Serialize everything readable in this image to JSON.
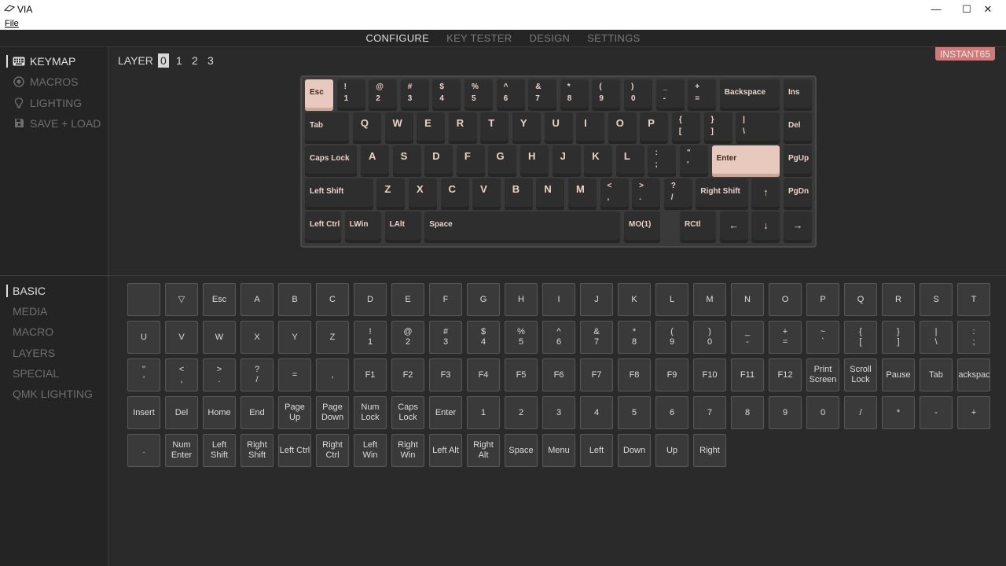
{
  "window": {
    "title": "VIA",
    "minimize": "—",
    "maximize": "☐",
    "close": "✕"
  },
  "menu": {
    "file": "File"
  },
  "nav": {
    "tabs": [
      "CONFIGURE",
      "KEY TESTER",
      "DESIGN",
      "SETTINGS"
    ],
    "active": "CONFIGURE"
  },
  "sidebar": {
    "items": [
      {
        "label": "KEYMAP",
        "icon": "keyboard-icon",
        "active": true
      },
      {
        "label": "MACROS",
        "icon": "macro-circle-icon",
        "active": false
      },
      {
        "label": "LIGHTING",
        "icon": "lightbulb-icon",
        "active": false
      },
      {
        "label": "SAVE + LOAD",
        "icon": "floppy-disk-icon",
        "active": false
      }
    ]
  },
  "layer": {
    "label": "LAYER",
    "options": [
      "0",
      "1",
      "2",
      "3"
    ],
    "active": "0"
  },
  "device": {
    "name": "INSTANT65"
  },
  "colors": {
    "accent_key": "#e8c9bd",
    "badge": "#cc7a7a",
    "key_legend": "#ecd2c7",
    "background": "#2a2a2a"
  },
  "keyboard": {
    "rows": [
      [
        {
          "t": "Esc",
          "accent": true
        },
        {
          "top": "!",
          "bot": "1"
        },
        {
          "top": "@",
          "bot": "2"
        },
        {
          "top": "#",
          "bot": "3"
        },
        {
          "top": "$",
          "bot": "4"
        },
        {
          "top": "%",
          "bot": "5"
        },
        {
          "top": "^",
          "bot": "6"
        },
        {
          "top": "&",
          "bot": "7"
        },
        {
          "top": "*",
          "bot": "8"
        },
        {
          "top": "(",
          "bot": "9"
        },
        {
          "top": ")",
          "bot": "0"
        },
        {
          "top": "_",
          "bot": "-"
        },
        {
          "top": "+",
          "bot": "="
        },
        {
          "t": "Backspace"
        },
        {
          "t": "Ins"
        }
      ],
      [
        {
          "t": "Tab"
        },
        {
          "big": "Q"
        },
        {
          "big": "W"
        },
        {
          "big": "E"
        },
        {
          "big": "R"
        },
        {
          "big": "T"
        },
        {
          "big": "Y"
        },
        {
          "big": "U"
        },
        {
          "big": "I"
        },
        {
          "big": "O"
        },
        {
          "big": "P"
        },
        {
          "top": "{",
          "bot": "["
        },
        {
          "top": "}",
          "bot": "]"
        },
        {
          "top": "|",
          "bot": "\\"
        },
        {
          "t": "Del"
        }
      ],
      [
        {
          "t": "Caps Lock"
        },
        {
          "big": "A"
        },
        {
          "big": "S"
        },
        {
          "big": "D"
        },
        {
          "big": "F"
        },
        {
          "big": "G"
        },
        {
          "big": "H"
        },
        {
          "big": "J"
        },
        {
          "big": "K"
        },
        {
          "big": "L"
        },
        {
          "top": ":",
          "bot": ";"
        },
        {
          "top": "\"",
          "bot": "'"
        },
        {
          "t": "Enter",
          "accent": true
        },
        {
          "t": "PgUp"
        }
      ],
      [
        {
          "t": "Left Shift"
        },
        {
          "big": "Z"
        },
        {
          "big": "X"
        },
        {
          "big": "C"
        },
        {
          "big": "V"
        },
        {
          "big": "B"
        },
        {
          "big": "N"
        },
        {
          "big": "M"
        },
        {
          "top": "<",
          "bot": ","
        },
        {
          "top": ">",
          "bot": "."
        },
        {
          "top": "?",
          "bot": "/"
        },
        {
          "t": "Right Shift"
        },
        {
          "arrow": "↑"
        },
        {
          "t": "PgDn"
        }
      ],
      [
        {
          "t": "Left Ctrl"
        },
        {
          "t": "LWin"
        },
        {
          "t": "LAlt"
        },
        {
          "t": "Space"
        },
        {
          "t": "MO(1)"
        },
        {
          "t": "RCtl"
        },
        {
          "arrow": "←"
        },
        {
          "arrow": "↓"
        },
        {
          "arrow": "→"
        }
      ]
    ]
  },
  "categories": [
    {
      "label": "BASIC",
      "active": true
    },
    {
      "label": "MEDIA",
      "active": false
    },
    {
      "label": "MACRO",
      "active": false
    },
    {
      "label": "LAYERS",
      "active": false
    },
    {
      "label": "SPECIAL",
      "active": false
    },
    {
      "label": "QMK LIGHTING",
      "active": false
    }
  ],
  "palette": [
    [
      "",
      "▽",
      "Esc",
      "A",
      "B",
      "C",
      "D",
      "E",
      "F",
      "G",
      "H",
      "I",
      "J",
      "K",
      "L",
      "M",
      "N",
      "O",
      "P",
      "Q",
      "R",
      "S",
      "T"
    ],
    [
      "U",
      "V",
      "W",
      "X",
      "Y",
      "Z",
      "!\n1",
      "@\n2",
      "#\n3",
      "$\n4",
      "%\n5",
      "^\n6",
      "&\n7",
      "*\n8",
      "(\n9",
      ")\n0",
      "_\n-",
      "+\n=",
      "~\n`",
      "{\n[",
      "}\n]",
      "|\n\\",
      ":\n;"
    ],
    [
      "\"\n'",
      "<\n,",
      ">\n.",
      "?\n/",
      "=",
      ",",
      "F1",
      "F2",
      "F3",
      "F4",
      "F5",
      "F6",
      "F7",
      "F8",
      "F9",
      "F10",
      "F11",
      "F12",
      "Print\nScreen",
      "Scroll\nLock",
      "Pause",
      "Tab",
      "Backspace"
    ],
    [
      "Insert",
      "Del",
      "Home",
      "End",
      "Page Up",
      "Page\nDown",
      "Num\nLock",
      "Caps\nLock",
      "Enter",
      "1",
      "2",
      "3",
      "4",
      "5",
      "6",
      "7",
      "8",
      "9",
      "0",
      "/",
      "*",
      "-",
      "+"
    ],
    [
      ".",
      "Num\nEnter",
      "Left\nShift",
      "Right\nShift",
      "Left Ctrl",
      "Right\nCtrl",
      "Left Win",
      "Right\nWin",
      "Left Alt",
      "Right Alt",
      "Space",
      "Menu",
      "Left",
      "Down",
      "Up",
      "Right"
    ]
  ]
}
